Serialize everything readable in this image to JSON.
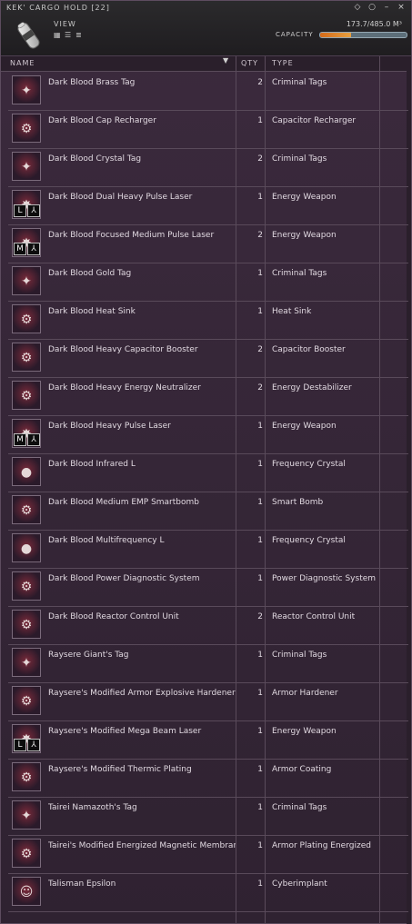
{
  "window": {
    "title": "KEK' CARGO HOLD [22]",
    "view_label": "VIEW",
    "capacity_label": "CAPACITY",
    "capacity_readout": "173.7/485.0 M³",
    "capacity_fraction": 0.358,
    "accent": "#d46b1a"
  },
  "table": {
    "headers": {
      "name": "NAME",
      "qty": "QTY",
      "type": "TYPE"
    },
    "rows": [
      {
        "name": "Dark Blood Brass Tag",
        "qty": "2",
        "type": "Criminal Tags",
        "icon": "tag-icon"
      },
      {
        "name": "Dark Blood Cap Recharger",
        "qty": "1",
        "type": "Capacitor Recharger",
        "icon": "module-icon"
      },
      {
        "name": "Dark Blood Crystal Tag",
        "qty": "2",
        "type": "Criminal Tags",
        "icon": "tag-icon"
      },
      {
        "name": "Dark Blood Dual Heavy Pulse Laser",
        "qty": "1",
        "type": "Energy Weapon",
        "icon": "laser-icon",
        "slot": "L"
      },
      {
        "name": "Dark Blood Focused Medium Pulse Laser",
        "qty": "2",
        "type": "Energy Weapon",
        "icon": "laser-icon",
        "slot": "M"
      },
      {
        "name": "Dark Blood Gold Tag",
        "qty": "1",
        "type": "Criminal Tags",
        "icon": "tag-icon"
      },
      {
        "name": "Dark Blood Heat Sink",
        "qty": "1",
        "type": "Heat Sink",
        "icon": "module-icon"
      },
      {
        "name": "Dark Blood Heavy Capacitor Booster",
        "qty": "2",
        "type": "Capacitor Booster",
        "icon": "module-icon"
      },
      {
        "name": "Dark Blood Heavy Energy Neutralizer",
        "qty": "2",
        "type": "Energy Destabilizer",
        "icon": "module-icon"
      },
      {
        "name": "Dark Blood Heavy Pulse Laser",
        "qty": "1",
        "type": "Energy Weapon",
        "icon": "laser-icon",
        "slot": "M"
      },
      {
        "name": "Dark Blood Infrared L",
        "qty": "1",
        "type": "Frequency Crystal",
        "icon": "crystal-icon"
      },
      {
        "name": "Dark Blood Medium EMP Smartbomb",
        "qty": "1",
        "type": "Smart Bomb",
        "icon": "module-icon"
      },
      {
        "name": "Dark Blood Multifrequency L",
        "qty": "1",
        "type": "Frequency Crystal",
        "icon": "crystal-icon"
      },
      {
        "name": "Dark Blood Power Diagnostic System",
        "qty": "1",
        "type": "Power Diagnostic System",
        "icon": "module-icon"
      },
      {
        "name": "Dark Blood Reactor Control Unit",
        "qty": "2",
        "type": "Reactor Control Unit",
        "icon": "module-icon"
      },
      {
        "name": "Raysere Giant's Tag",
        "qty": "1",
        "type": "Criminal Tags",
        "icon": "tag-icon"
      },
      {
        "name": "Raysere's Modified Armor Explosive Hardener",
        "qty": "1",
        "type": "Armor Hardener",
        "icon": "module-icon"
      },
      {
        "name": "Raysere's Modified Mega Beam Laser",
        "qty": "1",
        "type": "Energy Weapon",
        "icon": "laser-icon",
        "slot": "L"
      },
      {
        "name": "Raysere's Modified Thermic Plating",
        "qty": "1",
        "type": "Armor Coating",
        "icon": "module-icon"
      },
      {
        "name": "Tairei Namazoth's Tag",
        "qty": "1",
        "type": "Criminal Tags",
        "icon": "tag-icon"
      },
      {
        "name": "Tairei's Modified Energized Magnetic Membran",
        "qty": "1",
        "type": "Armor Plating Energized",
        "icon": "module-icon"
      },
      {
        "name": "Talisman Epsilon",
        "qty": "1",
        "type": "Cyberimplant",
        "icon": "implant-icon"
      }
    ]
  }
}
